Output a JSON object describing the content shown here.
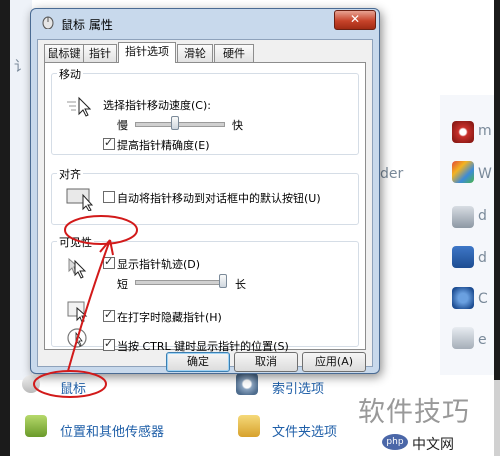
{
  "dialog": {
    "title": "鼠标 属性",
    "close_label": "✕",
    "tabs": [
      "鼠标键",
      "指针",
      "指针选项",
      "滑轮",
      "硬件"
    ],
    "active_tab": 2,
    "motion": {
      "group_label": "移动",
      "speed_label": "选择指针移动速度(C):",
      "slow_label": "慢",
      "fast_label": "快",
      "speed_level": 0.45,
      "precision_label": "提高指针精确度(E)",
      "precision_checked": true
    },
    "snap": {
      "group_label": "对齐",
      "snap_label": "自动将指针移动到对话框中的默认按钮(U)",
      "snap_checked": false
    },
    "visibility": {
      "group_label": "可见性",
      "trails_label": "显示指针轨迹(D)",
      "trails_checked": true,
      "short_label": "短",
      "long_label": "长",
      "trails_level": 1.0,
      "hide_label": "在打字时隐藏指针(H)",
      "hide_checked": true,
      "ctrl_label": "当按 CTRL 键时显示指针的位置(S)",
      "ctrl_checked": true
    },
    "buttons": {
      "ok": "确定",
      "cancel": "取消",
      "apply": "应用(A)"
    }
  },
  "control_panel": {
    "partial_left": "讠",
    "partial_der": "der",
    "right_labels": [
      "m",
      "W",
      "d",
      "d",
      "C",
      "e",
      "q",
      "l"
    ],
    "items": {
      "mouse": "鼠标",
      "index": "索引选项",
      "location": "位置和其他传感器",
      "folder": "文件夹选项"
    }
  },
  "watermark": {
    "main": "软件技巧",
    "logo": "中文网",
    "logo_prefix": "php"
  },
  "colors": {
    "annotation": "#d21a1a",
    "link": "#1f5fa8"
  }
}
